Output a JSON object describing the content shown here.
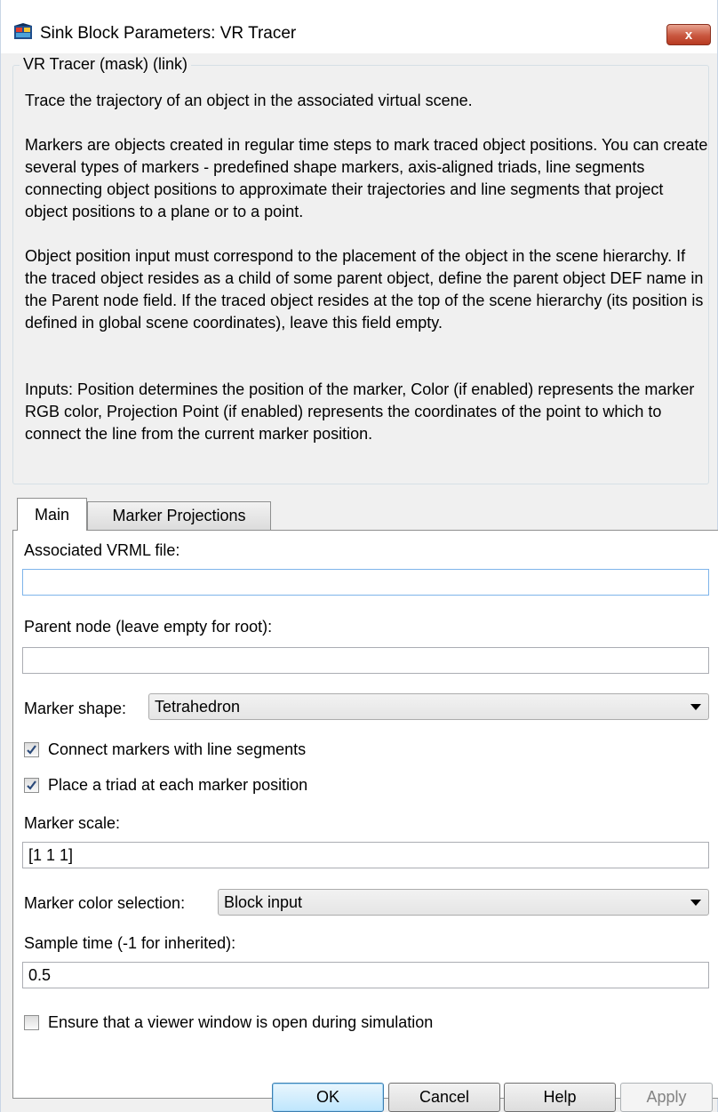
{
  "window": {
    "title": "Sink Block Parameters: VR Tracer",
    "close_label": "x"
  },
  "mask": {
    "group_title": "VR Tracer (mask) (link)",
    "paragraphs": [
      "Trace the trajectory of an object in the associated virtual scene.",
      "Markers are objects created in regular time steps to mark traced object positions. You can create several types of markers - predefined shape markers, axis-aligned triads, line segments connecting object positions to approximate their trajectories and line segments that project object positions to a plane or to a point.",
      "Object position input must correspond to the placement of the object in the scene hierarchy. If the traced object resides as a child of some parent object, define the parent object DEF name in the Parent node field. If the traced object resides at the top of the scene hierarchy (its position is defined in global scene coordinates), leave this field empty.",
      "Inputs: Position determines the position of the marker, Color (if enabled) represents the marker RGB color, Projection Point (if enabled) represents the coordinates of the point to which to connect the line from the current marker position."
    ]
  },
  "tabs": [
    {
      "label": "Main",
      "active": true
    },
    {
      "label": "Marker Projections",
      "active": false
    }
  ],
  "main": {
    "vrml_label": "Associated VRML file:",
    "vrml_value": "",
    "parent_label": "Parent node (leave empty for root):",
    "parent_value": "",
    "shape_label": "Marker shape:",
    "shape_value": "Tetrahedron",
    "connect_label": "Connect markers with line segments",
    "connect_checked": true,
    "triad_label": "Place a triad at each marker position",
    "triad_checked": true,
    "scale_label": "Marker scale:",
    "scale_value": "[1 1 1]",
    "color_label": "Marker color selection:",
    "color_value": "Block input",
    "sample_label": "Sample time (-1 for inherited):",
    "sample_value": "0.5",
    "viewer_label": "Ensure that a viewer window is open during simulation",
    "viewer_checked": false
  },
  "buttons": {
    "ok": "OK",
    "cancel": "Cancel",
    "help": "Help",
    "apply": "Apply"
  },
  "colors": {
    "close_button": "#c9573f",
    "default_button_border": "#3c7fb1",
    "focus_border": "#7eb4ea",
    "window_bg": "#f0f0f0"
  }
}
